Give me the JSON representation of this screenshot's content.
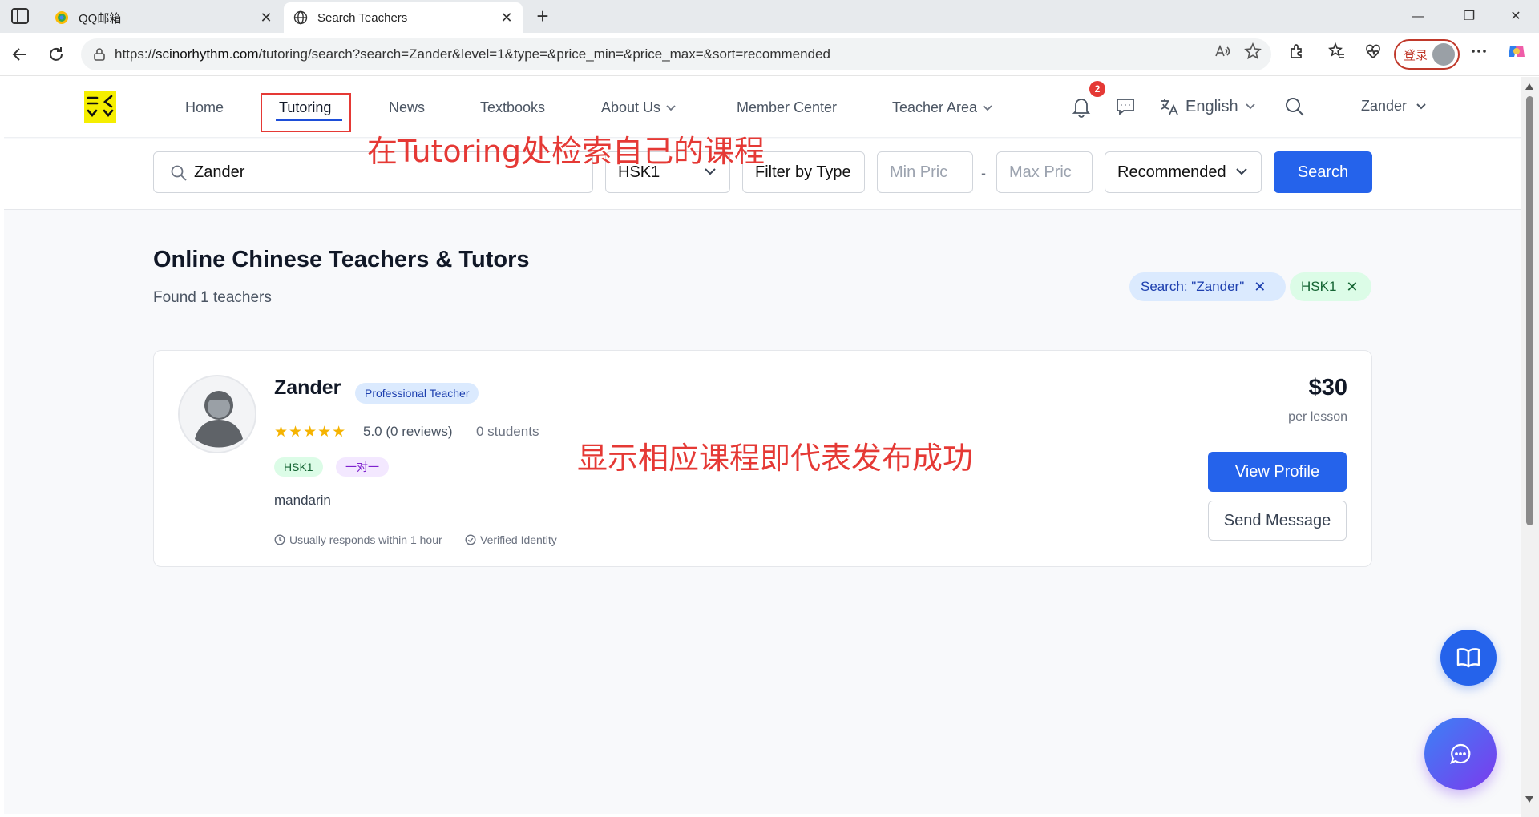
{
  "browser": {
    "tabs": [
      {
        "title": "QQ邮箱",
        "active": false
      },
      {
        "title": "Search Teachers",
        "active": true
      }
    ],
    "url_prefix": "https://",
    "url_host": "scinorhythm.com",
    "url_path": "/tutoring/search?search=Zander&level=1&type=&price_min=&price_max=&sort=recommended",
    "login_label": "登录"
  },
  "header": {
    "nav": {
      "home": "Home",
      "tutoring": "Tutoring",
      "news": "News",
      "textbooks": "Textbooks",
      "about": "About Us",
      "member": "Member Center",
      "teacher_area": "Teacher Area"
    },
    "notification_count": "2",
    "language": "English",
    "user": "Zander"
  },
  "annotations": {
    "search_hint": "在Tutoring处检索自己的课程",
    "success_hint": "显示相应课程即代表发布成功"
  },
  "search": {
    "query": "Zander",
    "level": "HSK1",
    "type_placeholder": "Filter by Type",
    "min_price_placeholder": "Min Pric",
    "price_separator": "-",
    "max_price_placeholder": "Max Pric",
    "sort": "Recommended",
    "button": "Search"
  },
  "results": {
    "title": "Online Chinese Teachers & Tutors",
    "count_text": "Found 1 teachers",
    "filters": [
      {
        "label": "Search: \"Zander\""
      },
      {
        "label": "HSK1"
      }
    ]
  },
  "teacher": {
    "name": "Zander",
    "badge": "Professional Teacher",
    "stars": "★★★★★",
    "rating_text": "5.0 (0 reviews)",
    "students_text": "0 students",
    "tags": [
      "HSK1",
      "一对一"
    ],
    "language": "mandarin",
    "response_text": "Usually responds within 1 hour",
    "verified_text": "Verified Identity",
    "price": "$30",
    "price_unit": "per lesson",
    "view_profile": "View Profile",
    "send_message": "Send Message"
  },
  "colors": {
    "primary": "#2563eb",
    "annotation_red": "#e53935",
    "logo_yellow": "#f5ee00",
    "star": "#f5b301"
  },
  "icons": [
    "sidebar-icon",
    "qq-mail-icon",
    "globe-icon",
    "close-icon",
    "plus-icon",
    "back-icon",
    "refresh-icon",
    "lock-icon",
    "read-aloud-icon",
    "star-icon",
    "extensions-icon",
    "favorites-icon",
    "health-icon",
    "more-icon",
    "copilot-icon",
    "bell-icon",
    "chat-icon",
    "translate-icon",
    "search-icon",
    "chevron-down-icon",
    "clock-icon",
    "check-circle-icon",
    "book-icon",
    "message-icon"
  ]
}
